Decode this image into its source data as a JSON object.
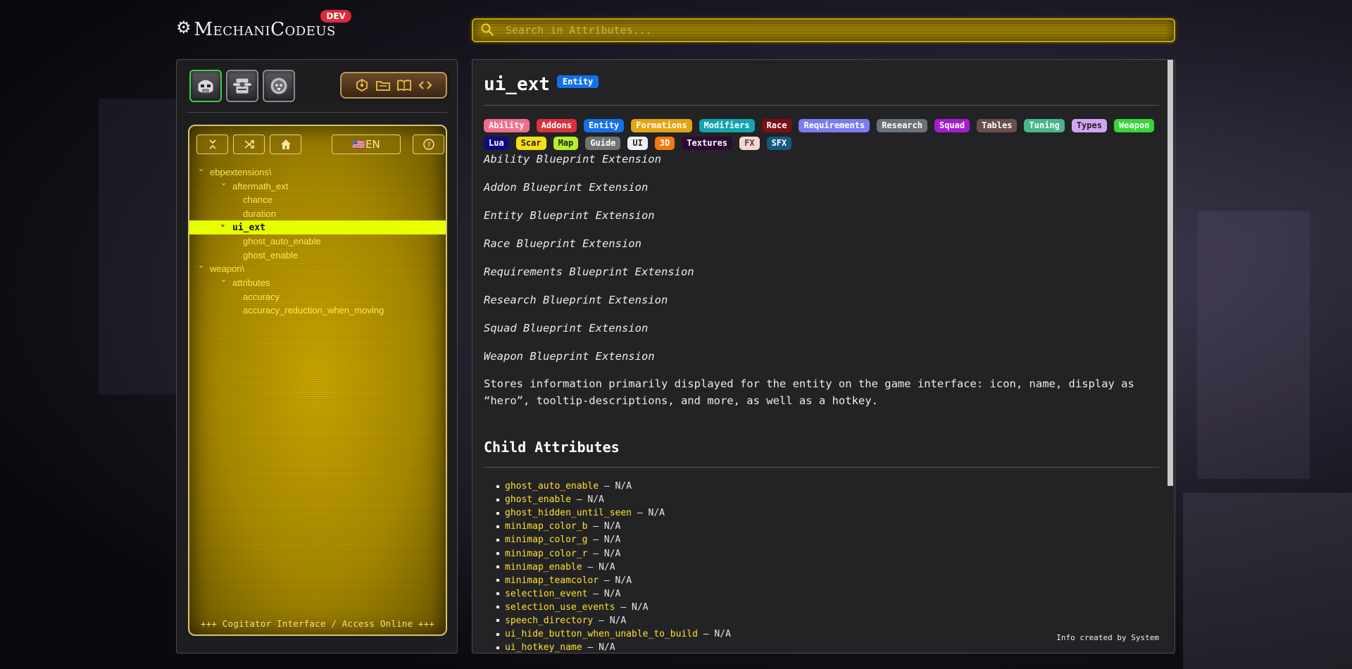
{
  "header": {
    "logo_text": "MechaniCodeus",
    "dev_badge": "DEV",
    "search_placeholder": "Search in Attributes..."
  },
  "left_panel": {
    "faction_buttons": [
      {
        "name": "space-marine-icon",
        "active": true
      },
      {
        "name": "imperial-guard-icon",
        "active": false
      },
      {
        "name": "skull-emblem-icon",
        "active": false
      }
    ],
    "tool_icons": [
      "cube-network-icon",
      "folder-icon",
      "book-icon",
      "code-icon"
    ],
    "toolbar": {
      "language_label": "🇺🇸EN"
    },
    "tree": [
      {
        "label": "ebpextensions\\",
        "level": 0,
        "expanded": true
      },
      {
        "label": "aftermath_ext",
        "level": 1,
        "expanded": true
      },
      {
        "label": "chance",
        "level": 2
      },
      {
        "label": "duration",
        "level": 2
      },
      {
        "label": "ui_ext",
        "level": 1,
        "expanded": true,
        "selected": true
      },
      {
        "label": "ghost_auto_enable",
        "level": 2
      },
      {
        "label": "ghost_enable",
        "level": 2
      },
      {
        "label": "weapon\\",
        "level": 0,
        "expanded": true
      },
      {
        "label": "attributes",
        "level": 1,
        "expanded": true
      },
      {
        "label": "accuracy",
        "level": 2
      },
      {
        "label": "accuracy_reduction_when_moving",
        "level": 2
      }
    ],
    "footer": "+++ Cogitator Interface / Access Online +++"
  },
  "main": {
    "title": "ui_ext",
    "badge": "Entity",
    "tags": [
      {
        "label": "Ability",
        "bg": "#f06e8c",
        "fg": "#ffffff"
      },
      {
        "label": "Addons",
        "bg": "#d9313f",
        "fg": "#ffffff"
      },
      {
        "label": "Entity",
        "bg": "#1570e8",
        "fg": "#ffffff"
      },
      {
        "label": "Formations",
        "bg": "#e3a510",
        "fg": "#ffffff"
      },
      {
        "label": "Modifiers",
        "bg": "#14a3b0",
        "fg": "#ffffff"
      },
      {
        "label": "Race",
        "bg": "#7a0f14",
        "fg": "#ffffff"
      },
      {
        "label": "Requirements",
        "bg": "#7b7cf0",
        "fg": "#ffffff"
      },
      {
        "label": "Research",
        "bg": "#6a7178",
        "fg": "#ffffff"
      },
      {
        "label": "Squad",
        "bg": "#a51cd0",
        "fg": "#ffffff"
      },
      {
        "label": "Tables",
        "bg": "#6a4f4a",
        "fg": "#ffffff"
      },
      {
        "label": "Tuning",
        "bg": "#4ab58a",
        "fg": "#ffffff"
      },
      {
        "label": "Types",
        "bg": "#cfa6f0",
        "fg": "#222222"
      },
      {
        "label": "Weapon",
        "bg": "#36d636",
        "fg": "#ffffff"
      },
      {
        "label": "Lua",
        "bg": "#0c0c80",
        "fg": "#ffffff"
      },
      {
        "label": "Scar",
        "bg": "#f6dd1a",
        "fg": "#222222"
      },
      {
        "label": "Map",
        "bg": "#b7f02a",
        "fg": "#222222"
      },
      {
        "label": "Guide",
        "bg": "#6d7570",
        "fg": "#ffffff"
      },
      {
        "label": "UI",
        "bg": "#eef0f6",
        "fg": "#222222"
      },
      {
        "label": "3D",
        "bg": "#f07a10",
        "fg": "#ffffff"
      },
      {
        "label": "Textures",
        "bg": "#2c0a32",
        "fg": "#ffffff"
      },
      {
        "label": "FX",
        "bg": "#f8d6cc",
        "fg": "#444444"
      },
      {
        "label": "SFX",
        "bg": "#155a80",
        "fg": "#ffffff"
      }
    ],
    "extensions": [
      "Ability Blueprint Extension",
      "Addon Blueprint Extension",
      "Entity Blueprint Extension",
      "Race Blueprint Extension",
      "Requirements Blueprint Extension",
      "Research Blueprint Extension",
      "Squad Blueprint Extension",
      "Weapon Blueprint Extension"
    ],
    "description": "Stores information primarily displayed for the entity on the game interface: icon, name, display as “hero”, tooltip-descriptions, and more, as well as a hotkey.",
    "child_heading": "Child Attributes",
    "child_attributes": [
      {
        "name": "ghost_auto_enable",
        "value": "N/A"
      },
      {
        "name": "ghost_enable",
        "value": "N/A"
      },
      {
        "name": "ghost_hidden_until_seen",
        "value": "N/A"
      },
      {
        "name": "minimap_color_b",
        "value": "N/A"
      },
      {
        "name": "minimap_color_g",
        "value": "N/A"
      },
      {
        "name": "minimap_color_r",
        "value": "N/A"
      },
      {
        "name": "minimap_enable",
        "value": "N/A"
      },
      {
        "name": "minimap_teamcolor",
        "value": "N/A"
      },
      {
        "name": "selection_event",
        "value": "N/A"
      },
      {
        "name": "selection_use_events",
        "value": "N/A"
      },
      {
        "name": "speech_directory",
        "value": "N/A"
      },
      {
        "name": "ui_hide_button_when_unable_to_build",
        "value": "N/A"
      },
      {
        "name": "ui_hotkey_name",
        "value": "N/A"
      }
    ],
    "info_created": "Info created by System"
  }
}
